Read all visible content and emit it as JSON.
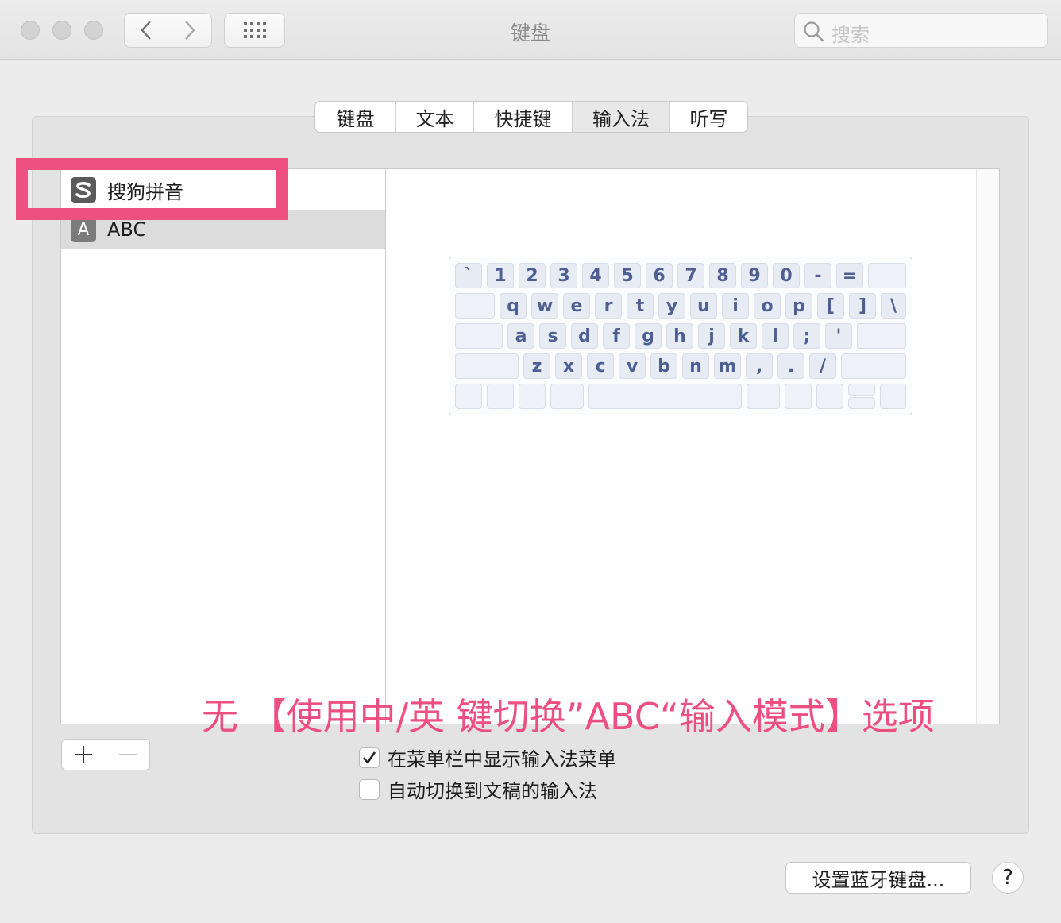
{
  "window": {
    "title": "键盘"
  },
  "search": {
    "placeholder": "搜索"
  },
  "tabs": [
    {
      "label": "键盘"
    },
    {
      "label": "文本"
    },
    {
      "label": "快捷键"
    },
    {
      "label": "输入法"
    },
    {
      "label": "听写"
    }
  ],
  "input_sources": [
    {
      "label": "搜狗拼音",
      "icon": "sogou-s-icon"
    },
    {
      "label": "ABC",
      "icon": "letter-a-icon",
      "icon_text": "A"
    }
  ],
  "keyboard": {
    "row1": [
      "`",
      "1",
      "2",
      "3",
      "4",
      "5",
      "6",
      "7",
      "8",
      "9",
      "0",
      "-",
      "="
    ],
    "row2": [
      "q",
      "w",
      "e",
      "r",
      "t",
      "y",
      "u",
      "i",
      "o",
      "p",
      "[",
      "]",
      "\\"
    ],
    "row3": [
      "a",
      "s",
      "d",
      "f",
      "g",
      "h",
      "j",
      "k",
      "l",
      ";",
      "'"
    ],
    "row4": [
      "z",
      "x",
      "c",
      "v",
      "b",
      "n",
      "m",
      ",",
      ".",
      "/"
    ]
  },
  "add_remove": {
    "add": "+",
    "remove": "—"
  },
  "options": [
    {
      "label": "在菜单栏中显示输入法菜单",
      "checked": true
    },
    {
      "label": "自动切换到文稿的输入法",
      "checked": false
    }
  ],
  "annotation": "无 【使用中/英 键切换”ABC“输入模式】选项",
  "bottom": {
    "bluetooth_button": "设置蓝牙键盘...",
    "help_button": "?"
  },
  "colors": {
    "highlight": "#ee5082",
    "key_text": "#4d5f93"
  }
}
